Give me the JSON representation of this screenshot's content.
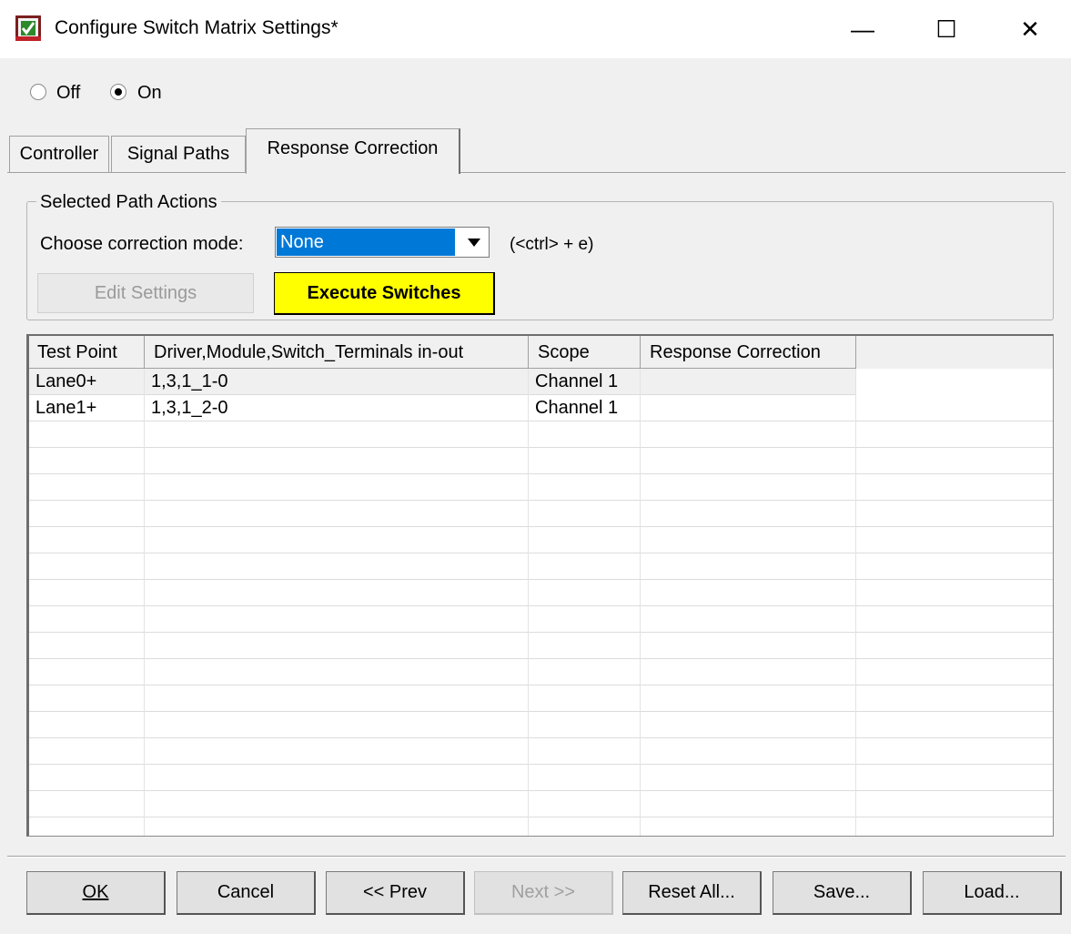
{
  "window": {
    "title": "Configure Switch Matrix Settings*",
    "minimize": "—",
    "maximize": "☐",
    "close": "✕"
  },
  "power": {
    "off_label": "Off",
    "on_label": "On",
    "selected": "On"
  },
  "tabs": [
    {
      "label": "Controller",
      "active": false
    },
    {
      "label": "Signal Paths",
      "active": false
    },
    {
      "label": "Response Correction",
      "active": true
    }
  ],
  "path_actions": {
    "legend": "Selected Path Actions",
    "mode_label": "Choose correction mode:",
    "mode_value": "None",
    "shortcut": "(<ctrl> + e)",
    "edit_settings": "Edit Settings",
    "execute_switches": "Execute Switches"
  },
  "table": {
    "columns": [
      "Test Point",
      "Driver,Module,Switch_Terminals in-out",
      "Scope",
      "Response Correction"
    ],
    "rows": [
      {
        "test_point": "Lane0+",
        "path": "1,3,1_1-0",
        "scope": "Channel 1",
        "correction": ""
      },
      {
        "test_point": "Lane1+",
        "path": "1,3,1_2-0",
        "scope": "Channel 1",
        "correction": ""
      }
    ]
  },
  "buttons": {
    "ok": "OK",
    "cancel": "Cancel",
    "prev": "<< Prev",
    "next": "Next >>",
    "reset_all": "Reset All...",
    "save": "Save...",
    "load": "Load..."
  },
  "colors": {
    "execute_bg": "#ffff00",
    "selection": "#0078d7"
  }
}
